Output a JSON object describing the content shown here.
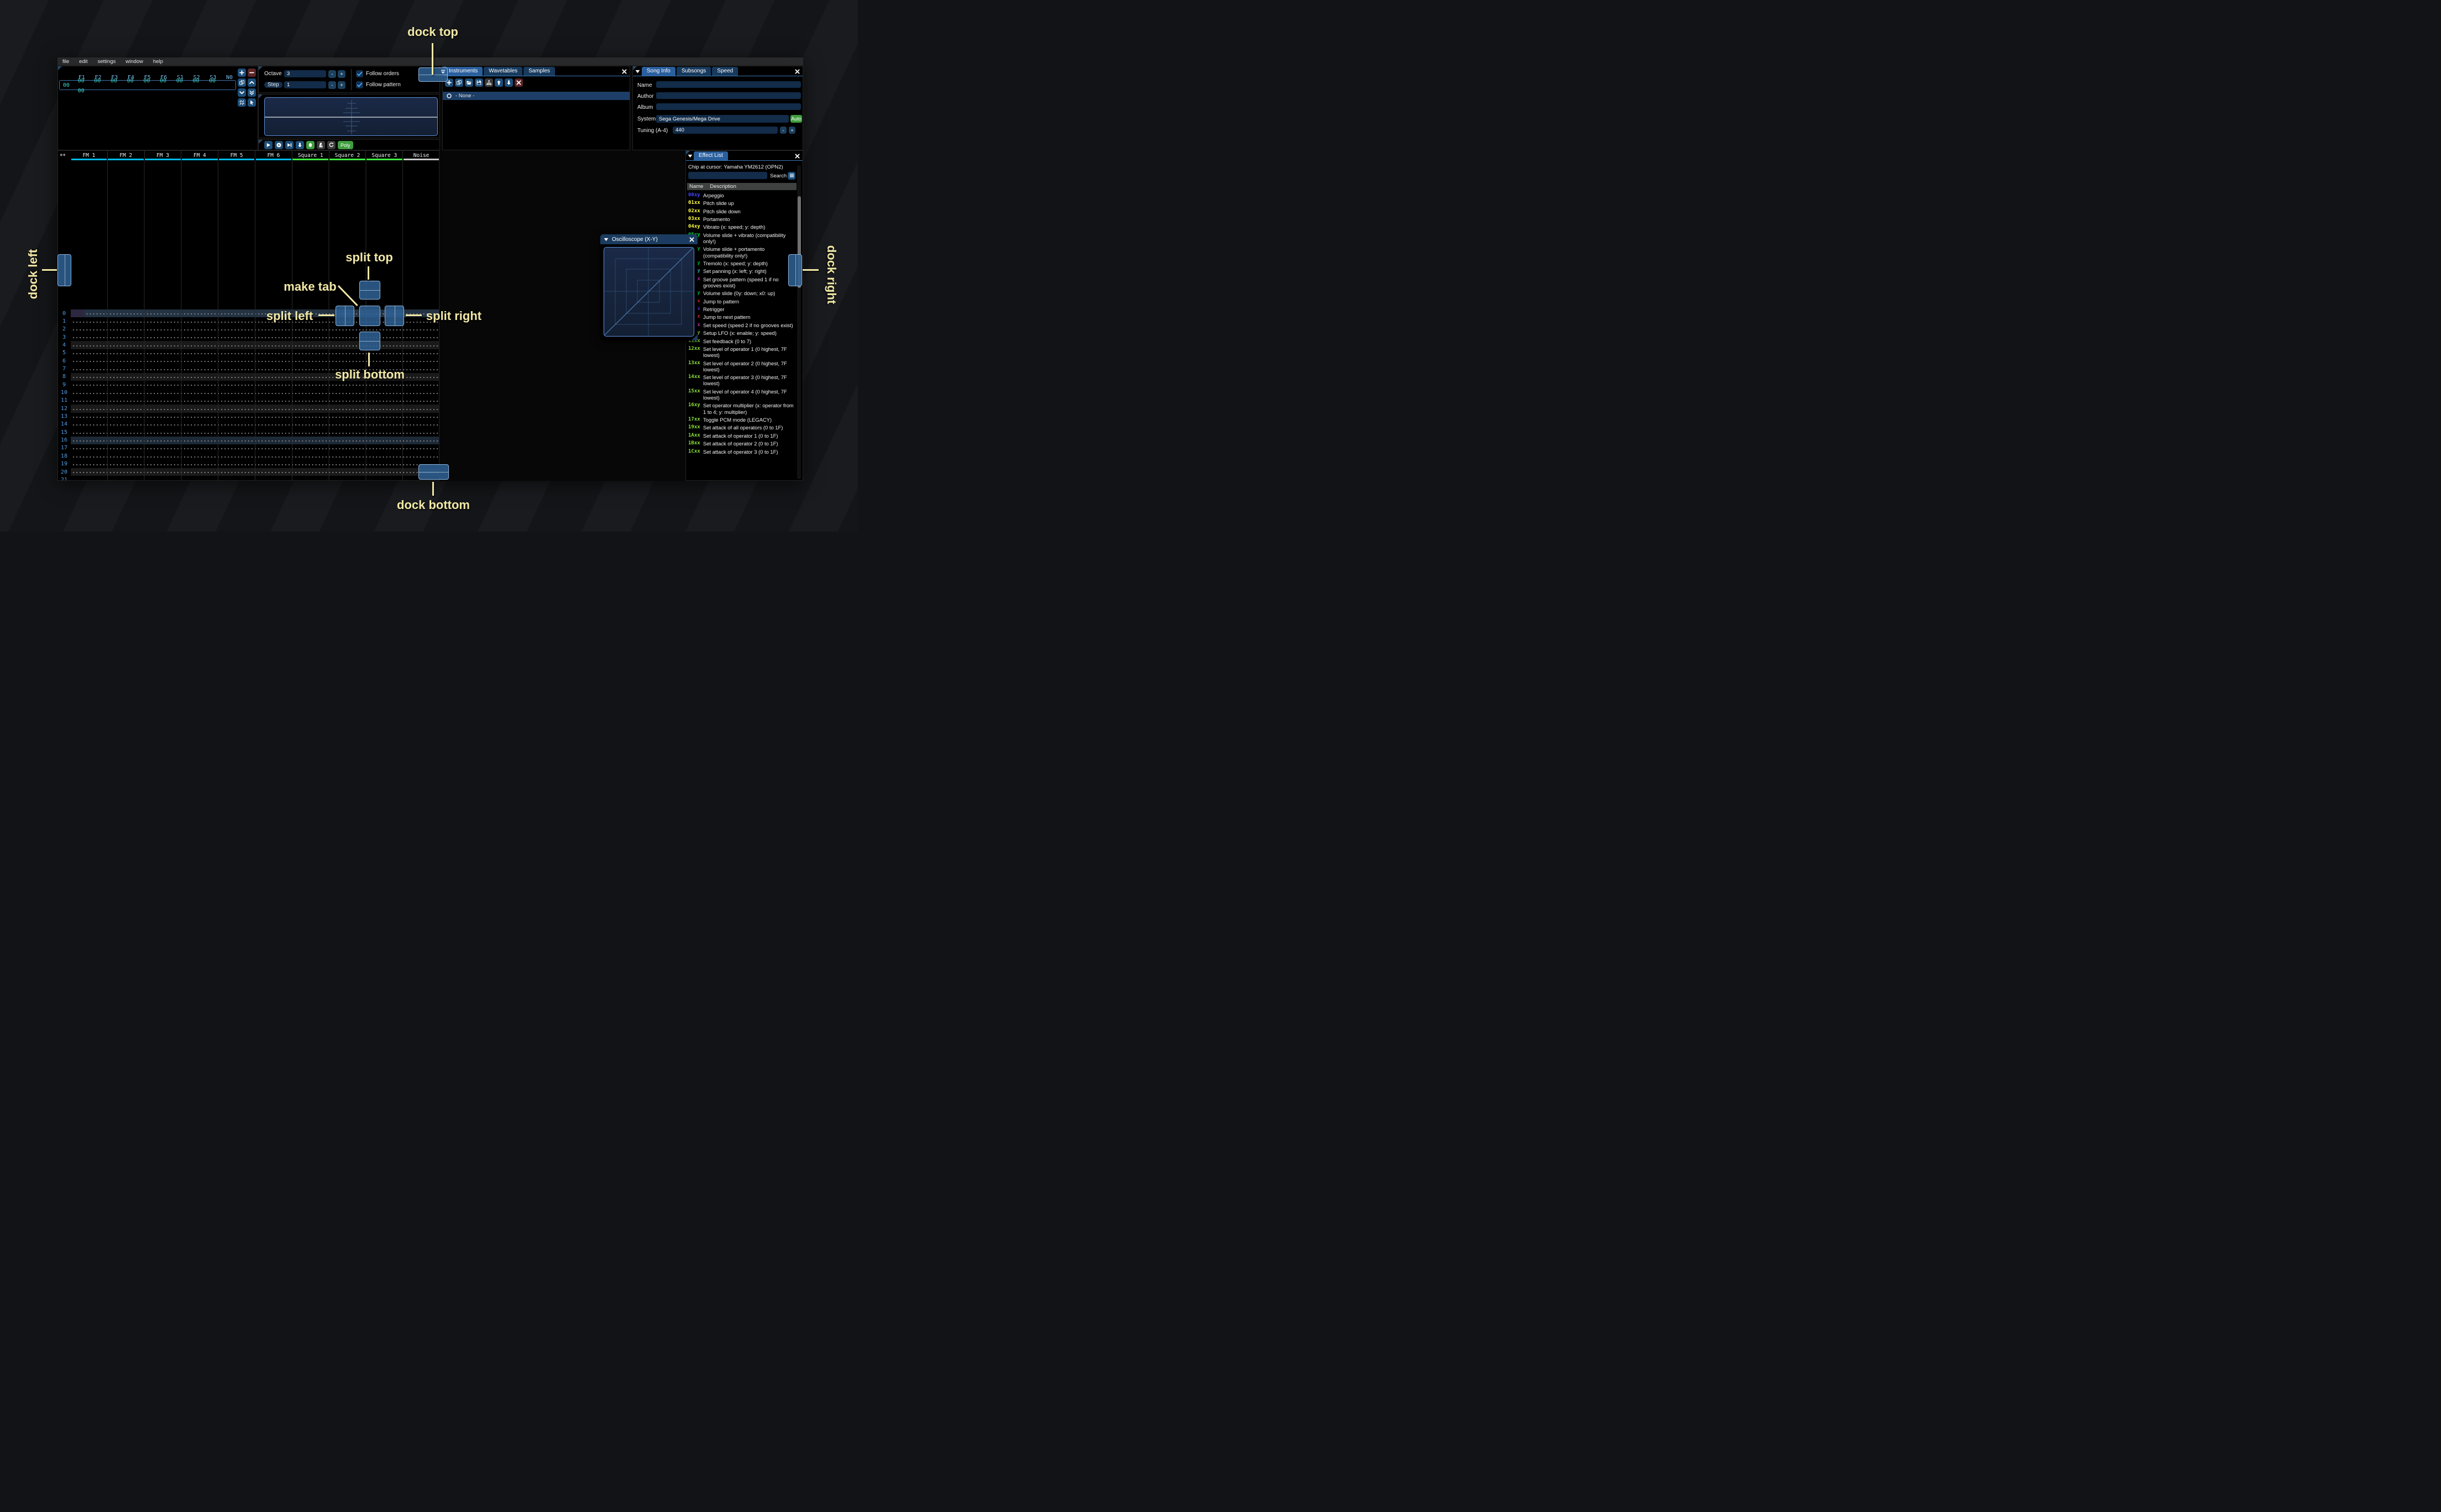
{
  "menu": {
    "items": [
      "file",
      "edit",
      "settings",
      "window",
      "help"
    ]
  },
  "orders": {
    "columns": [
      "F1",
      "F2",
      "F3",
      "F4",
      "F5",
      "F6",
      "S1",
      "S2",
      "S3",
      "N0"
    ],
    "row_index": "00",
    "row_values": [
      "00",
      "00",
      "00",
      "00",
      "00",
      "00",
      "00",
      "00",
      "00",
      "00"
    ],
    "buttons": [
      {
        "name": "add-order-button",
        "icon": "plus",
        "variant": ""
      },
      {
        "name": "remove-order-button",
        "icon": "minus",
        "variant": "red"
      },
      {
        "name": "duplicate-order-button",
        "icon": "copy",
        "variant": ""
      },
      {
        "name": "move-order-up-button",
        "icon": "cup",
        "variant": ""
      },
      {
        "name": "move-order-down-button",
        "icon": "cdn",
        "variant": ""
      },
      {
        "name": "duplicate-order-end-button",
        "icon": "cdn2",
        "variant": ""
      },
      {
        "name": "deep-clone-order-button",
        "icon": "unlink",
        "variant": ""
      },
      {
        "name": "order-edit-mode-button",
        "icon": "cursor",
        "variant": ""
      }
    ]
  },
  "transport": {
    "octave_label": "Octave",
    "octave_value": "3",
    "step_label": "Step",
    "step_value": "1",
    "dec_label": "-",
    "inc_label": "+",
    "follow_orders_label": "Follow orders",
    "follow_pattern_label": "Follow pattern",
    "buttons": [
      {
        "name": "play-button",
        "icon": "play",
        "variant": ""
      },
      {
        "name": "play-pattern-button",
        "icon": "pcirc",
        "variant": ""
      },
      {
        "name": "play-from-cursor-button",
        "icon": "skip",
        "variant": ""
      },
      {
        "name": "step-one-row-button",
        "icon": "adn",
        "variant": ""
      },
      {
        "name": "record-button",
        "icon": "rec",
        "variant": "green"
      },
      {
        "name": "metronome-button",
        "icon": "metr",
        "variant": "gray"
      },
      {
        "name": "repeat-pattern-button",
        "icon": "rep",
        "variant": "gray"
      },
      {
        "name": "poly-button",
        "label": "Poly",
        "variant": "green wide"
      }
    ]
  },
  "instruments_panel": {
    "tabs": [
      {
        "label": "Instruments",
        "active": true
      },
      {
        "label": "Wavetables",
        "active": false
      },
      {
        "label": "Samples",
        "active": false
      }
    ],
    "toolbar": [
      {
        "name": "add-instrument-button",
        "icon": "plus",
        "variant": ""
      },
      {
        "name": "duplicate-instrument-button",
        "icon": "copy",
        "variant": ""
      },
      {
        "name": "open-instrument-button",
        "icon": "folder",
        "variant": ""
      },
      {
        "name": "save-instrument-button",
        "icon": "save",
        "variant": ""
      },
      {
        "name": "instrument-type-button",
        "icon": "tree",
        "variant": "gray"
      },
      {
        "name": "move-instrument-up-button",
        "icon": "aup",
        "variant": ""
      },
      {
        "name": "move-instrument-down-button",
        "icon": "adn",
        "variant": ""
      },
      {
        "name": "delete-instrument-button",
        "icon": "x",
        "variant": "red"
      }
    ],
    "selected_item": "- None -"
  },
  "song_info": {
    "tabs": [
      {
        "label": "Song Info",
        "active": true
      },
      {
        "label": "Subsongs",
        "active": false
      },
      {
        "label": "Speed",
        "active": false
      }
    ],
    "name_label": "Name",
    "name_value": "",
    "author_label": "Author",
    "author_value": "",
    "album_label": "Album",
    "album_value": "",
    "system_label": "System",
    "system_value": "Sega Genesis/Mega Drive",
    "auto_label": "Auto",
    "tuning_label": "Tuning (A-4)",
    "tuning_value": "440"
  },
  "pattern": {
    "add_channel_label": "++",
    "channels": [
      {
        "label": "FM 1",
        "color": "#00b8e8"
      },
      {
        "label": "FM 2",
        "color": "#00b8e8"
      },
      {
        "label": "FM 3",
        "color": "#00b8e8"
      },
      {
        "label": "FM 4",
        "color": "#00b8e8"
      },
      {
        "label": "FM 5",
        "color": "#00b8e8"
      },
      {
        "label": "FM 6",
        "color": "#00b8e8"
      },
      {
        "label": "Square 1",
        "color": "#40e840"
      },
      {
        "label": "Square 2",
        "color": "#40e840"
      },
      {
        "label": "Square 3",
        "color": "#40e840"
      },
      {
        "label": "Noise",
        "color": "#c8c8c8"
      }
    ],
    "row_count": 22
  },
  "oscilloscope_window": {
    "title": "Oscilloscope (X-Y)"
  },
  "effect_list": {
    "tab_label": "Effect List",
    "chip_label": "Chip at cursor: Yamaha YM2612 (OPN2)",
    "search_value": "",
    "search_label": "Search",
    "name_col": "Name",
    "desc_col": "Description",
    "effects": [
      {
        "code": "00xy",
        "color": "#4545ff",
        "desc": "Arpeggio"
      },
      {
        "code": "01xx",
        "color": "#ffff44",
        "desc": "Pitch slide up"
      },
      {
        "code": "02xx",
        "color": "#ffff44",
        "desc": "Pitch slide down"
      },
      {
        "code": "03xx",
        "color": "#ffff44",
        "desc": "Portamento"
      },
      {
        "code": "04xy",
        "color": "#ffff44",
        "desc": "Vibrato (x: speed; y: depth)"
      },
      {
        "code": "05xy",
        "color": "#00e844",
        "desc": "Volume slide + vibrato (compatibility only!)"
      },
      {
        "code": "06xy",
        "color": "#00e844",
        "desc": "Volume slide + portamento (compatibility only!)"
      },
      {
        "code": "07xy",
        "color": "#00e844",
        "desc": "Tremolo (x: speed; y: depth)"
      },
      {
        "code": "08xy",
        "color": "#33d9e8",
        "desc": "Set panning (x: left; y: right)"
      },
      {
        "code": "09xx",
        "color": "#e838e8",
        "desc": "Set groove pattern (speed 1 if no grooves exist)"
      },
      {
        "code": "0Axy",
        "color": "#00e844",
        "desc": "Volume slide (0y: down; x0: up)"
      },
      {
        "code": "0Bxx",
        "color": "#ff3b3b",
        "desc": "Jump to pattern"
      },
      {
        "code": "0Cxx",
        "color": "#7a3bff",
        "desc": "Retrigger"
      },
      {
        "code": "0Dxx",
        "color": "#ff3b3b",
        "desc": "Jump to next pattern"
      },
      {
        "code": "0Fxx",
        "color": "#e838e8",
        "desc": "Set speed (speed 2 if no grooves exist)"
      },
      {
        "code": "10xy",
        "color": "#8ae03c",
        "desc": "Setup LFO (x: enable; y: speed)"
      },
      {
        "code": "11xx",
        "color": "#8ae03c",
        "desc": "Set feedback (0 to 7)"
      },
      {
        "code": "12xx",
        "color": "#8ae03c",
        "desc": "Set level of operator 1 (0 highest, 7F lowest)"
      },
      {
        "code": "13xx",
        "color": "#8ae03c",
        "desc": "Set level of operator 2 (0 highest, 7F lowest)"
      },
      {
        "code": "14xx",
        "color": "#8ae03c",
        "desc": "Set level of operator 3 (0 highest, 7F lowest)"
      },
      {
        "code": "15xx",
        "color": "#8ae03c",
        "desc": "Set level of operator 4 (0 highest, 7F lowest)"
      },
      {
        "code": "16xy",
        "color": "#8ae03c",
        "desc": "Set operator multiplier (x: operator from 1 to 4; y: multiplier)"
      },
      {
        "code": "17xx",
        "color": "#8ae03c",
        "desc": "Toggle PCM mode (LEGACY)"
      },
      {
        "code": "19xx",
        "color": "#8ae03c",
        "desc": "Set attack of all operators (0 to 1F)"
      },
      {
        "code": "1Axx",
        "color": "#8ae03c",
        "desc": "Set attack of operator 1 (0 to 1F)"
      },
      {
        "code": "1Bxx",
        "color": "#8ae03c",
        "desc": "Set attack of operator 2 (0 to 1F)"
      },
      {
        "code": "1Cxx",
        "color": "#8ae03c",
        "desc": "Set attack of operator 3 (0 to 1F)"
      }
    ]
  },
  "dock": {
    "labels": {
      "dock_top": "dock top",
      "dock_bottom": "dock bottom",
      "dock_left": "dock left",
      "dock_right": "dock right",
      "make_tab": "make tab",
      "split_top": "split top",
      "split_bottom": "split bottom",
      "split_left": "split left",
      "split_right": "split right"
    }
  },
  "colors": {
    "accent": "#2f6194",
    "annotation": "#f1e8a6",
    "fm_channel": "#00b8e8",
    "square_channel": "#40e840",
    "noise_channel": "#c8c8c8",
    "auto_green": "#3f9e3f"
  }
}
